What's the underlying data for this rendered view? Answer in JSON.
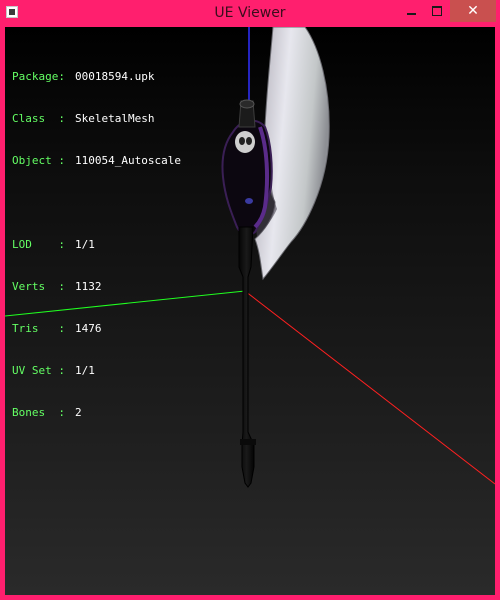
{
  "window": {
    "title": "UE Viewer",
    "controls": {
      "minimize": "",
      "maximize": "",
      "close": "✕"
    }
  },
  "info": {
    "group1": [
      {
        "label": "Package:",
        "value": "00018594.upk"
      },
      {
        "label": "Class  :",
        "value": "SkeletalMesh"
      },
      {
        "label": "Object :",
        "value": "110054_Autoscale"
      }
    ],
    "group2": [
      {
        "label": "LOD    :",
        "value": "1/1"
      },
      {
        "label": "Verts  :",
        "value": "1132"
      },
      {
        "label": "Tris   :",
        "value": "1476"
      },
      {
        "label": "UV Set :",
        "value": "1/1"
      },
      {
        "label": "Bones  :",
        "value": "2"
      }
    ]
  },
  "colors": {
    "window_frame": "#ff1f6e",
    "close_button": "#c9504f",
    "info_label": "#64ff64",
    "info_value": "#ffffff",
    "axis_x": "#ff2020",
    "axis_y": "#20ff20",
    "axis_z": "#3030ff"
  },
  "icons": {
    "app": "app-window-icon",
    "minimize": "minimize-icon",
    "maximize": "maximize-icon",
    "close": "close-icon"
  }
}
